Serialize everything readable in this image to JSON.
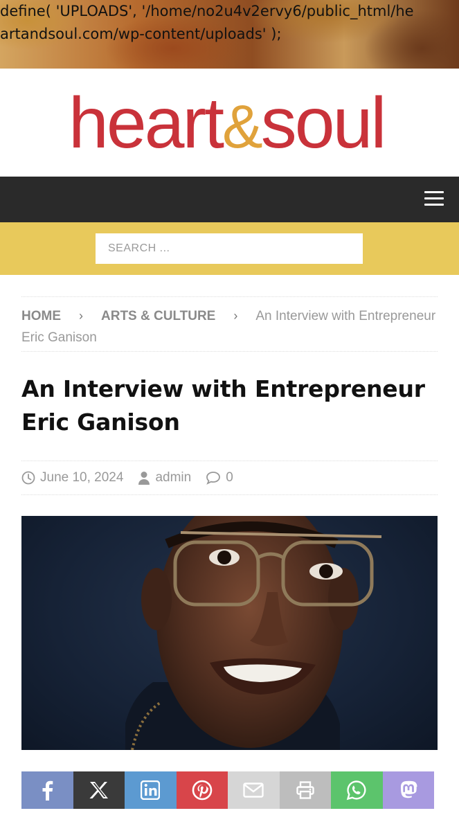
{
  "banner": {
    "code_text": "define( 'UPLOADS', '/home/no2u4v2ervy6/public_html/heartandsoul.com/wp-content/uploads' );"
  },
  "logo": {
    "part1": "heart",
    "amp": "&",
    "part2": "soul",
    "colors": {
      "text": "#c9323a",
      "amp": "#e0a23b"
    }
  },
  "nav": {
    "menu_icon": "hamburger-menu-icon",
    "background": "#2a2a2a"
  },
  "search": {
    "placeholder": "SEARCH ...",
    "background": "#e8c95b"
  },
  "breadcrumb": {
    "home": "HOME",
    "category": "ARTS & CULTURE",
    "current": "An Interview with Entrepreneur Eric Ganison",
    "separator": "›"
  },
  "article": {
    "title": "An Interview with Entrepreneur Eric Ganison",
    "date": "June 10, 2024",
    "author": "admin",
    "comments": "0"
  },
  "share": [
    {
      "network": "facebook",
      "icon": "facebook-icon",
      "color": "#7a8fc4"
    },
    {
      "network": "x",
      "icon": "x-icon",
      "color": "#3a3a3a"
    },
    {
      "network": "linkedin",
      "icon": "linkedin-icon",
      "color": "#5c9ad1"
    },
    {
      "network": "pinterest",
      "icon": "pinterest-icon",
      "color": "#d8454a"
    },
    {
      "network": "email",
      "icon": "email-icon",
      "color": "#d6d6d6"
    },
    {
      "network": "print",
      "icon": "print-icon",
      "color": "#bdbdbd"
    },
    {
      "network": "whatsapp",
      "icon": "whatsapp-icon",
      "color": "#5cc46c"
    },
    {
      "network": "mastodon",
      "icon": "mastodon-icon",
      "color": "#a89ae0"
    }
  ]
}
